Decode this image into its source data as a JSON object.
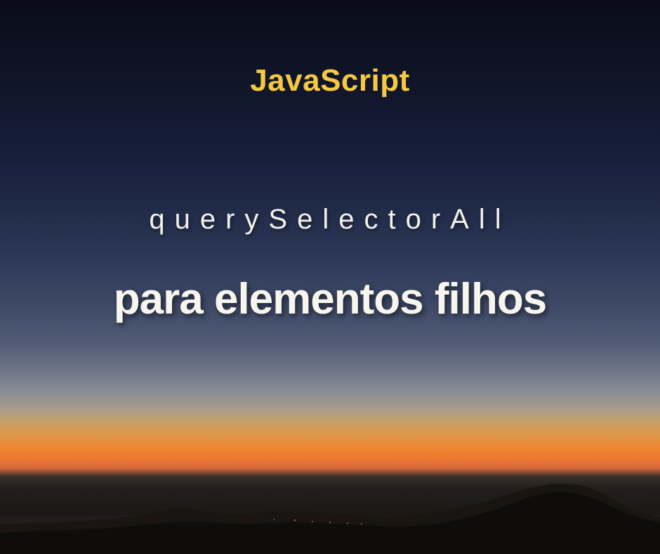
{
  "title": "JavaScript",
  "subtitle": "querySelectorAll",
  "main_text": "para elementos filhos"
}
